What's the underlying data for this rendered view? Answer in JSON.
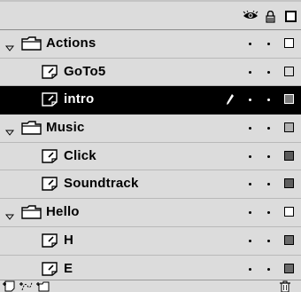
{
  "header": {
    "icons": [
      "eye-icon",
      "lock-icon",
      "outline-icon"
    ]
  },
  "rows": [
    {
      "kind": "folder",
      "label": "Actions",
      "expanded": true,
      "selected": false,
      "outline_color": "#ffffff"
    },
    {
      "kind": "layer",
      "label": "GoTo5",
      "selected": false,
      "outline_color": "#dcdcdc"
    },
    {
      "kind": "layer",
      "label": "intro",
      "selected": true,
      "editing": true,
      "outline_color": "#7a7a7a"
    },
    {
      "kind": "folder",
      "label": "Music",
      "expanded": true,
      "selected": false,
      "outline_color": "#b0b0b0"
    },
    {
      "kind": "layer",
      "label": "Click",
      "selected": false,
      "outline_color": "#5a5a5a"
    },
    {
      "kind": "layer",
      "label": "Soundtrack",
      "selected": false,
      "outline_color": "#5e5e5e"
    },
    {
      "kind": "folder",
      "label": "Hello",
      "expanded": true,
      "selected": false,
      "outline_color": "#ffffff"
    },
    {
      "kind": "layer",
      "label": "H",
      "selected": false,
      "outline_color": "#6a6a6a"
    },
    {
      "kind": "layer",
      "label": "E",
      "selected": false,
      "outline_color": "#6a6a6a"
    }
  ],
  "toolbar": {
    "icons": [
      "add-layer-icon",
      "add-motion-guide-icon",
      "add-folder-icon",
      "trash-icon"
    ]
  }
}
